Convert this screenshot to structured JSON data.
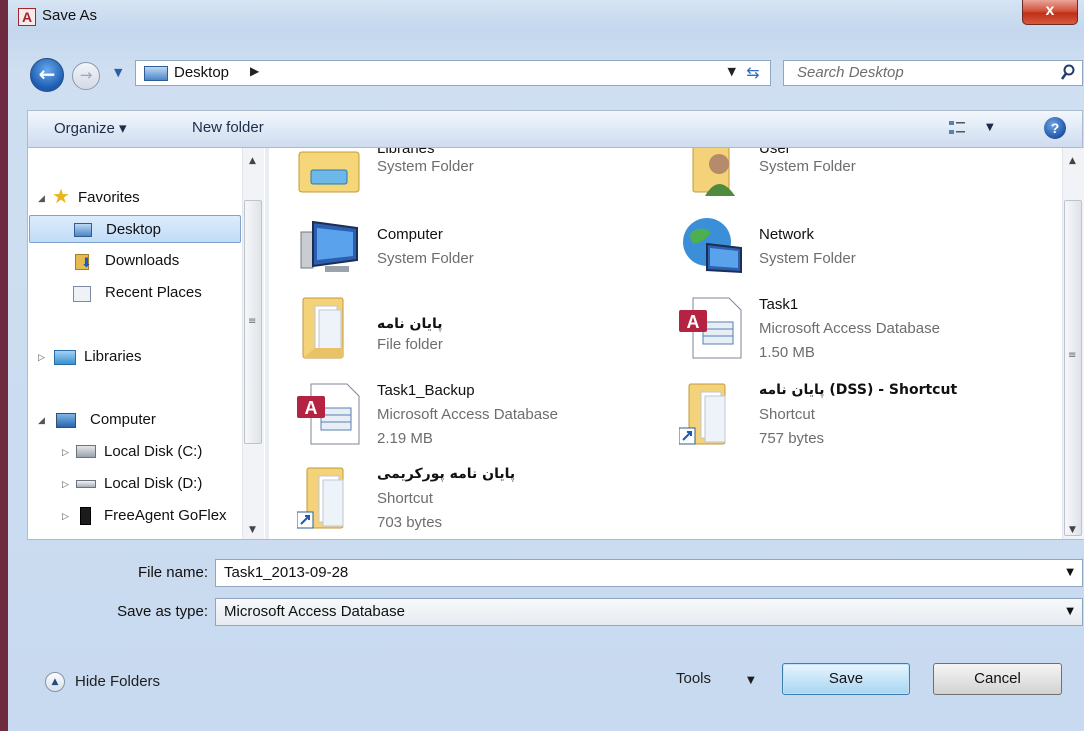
{
  "window": {
    "title": "Save As",
    "app_icon_letter": "A",
    "close_glyph": "x"
  },
  "nav": {
    "back_glyph": "←",
    "forward_glyph": "→",
    "address": {
      "location": "Desktop",
      "chevron": "▶"
    },
    "search": {
      "placeholder": "Search Desktop"
    }
  },
  "toolbar": {
    "organize_label": "Organize ▾",
    "new_folder_label": "New folder",
    "help_glyph": "?"
  },
  "sidebar": {
    "favorites": {
      "label": "Favorites",
      "items": [
        {
          "label": "Desktop",
          "selected": true
        },
        {
          "label": "Downloads"
        },
        {
          "label": "Recent Places"
        }
      ]
    },
    "libraries": {
      "label": "Libraries"
    },
    "computer": {
      "label": "Computer",
      "items": [
        {
          "label": "Local Disk (C:)"
        },
        {
          "label": "Local Disk (D:)"
        },
        {
          "label": "FreeAgent GoFlex"
        }
      ]
    }
  },
  "files": [
    {
      "name": "Libraries",
      "type": "System Folder",
      "size": "",
      "icon": "libraries-icon"
    },
    {
      "name": "User",
      "type": "System Folder",
      "size": "",
      "icon": "user-folder-icon"
    },
    {
      "name": "Computer",
      "type": "System Folder",
      "size": "",
      "icon": "computer-icon"
    },
    {
      "name": "Network",
      "type": "System Folder",
      "size": "",
      "icon": "network-icon"
    },
    {
      "name": "پایان نامه",
      "type": "File folder",
      "size": "",
      "icon": "folder-icon"
    },
    {
      "name": "Task1",
      "type": "Microsoft Access Database",
      "size": "1.50 MB",
      "icon": "access-database-icon"
    },
    {
      "name": "Task1_Backup",
      "type": "Microsoft Access Database",
      "size": "2.19 MB",
      "icon": "access-database-icon"
    },
    {
      "name": "پایان نامه (DSS) - Shortcut",
      "type": "Shortcut",
      "size": "757 bytes",
      "icon": "shortcut-folder-icon"
    },
    {
      "name": "پایان نامه پورکریمی",
      "type": "Shortcut",
      "size": "703 bytes",
      "icon": "shortcut-folder-icon"
    }
  ],
  "form": {
    "file_name_label": "File name:",
    "file_name_value": "Task1_2013-09-28",
    "save_type_label": "Save as type:",
    "save_type_value": "Microsoft Access Database"
  },
  "footer": {
    "hide_folders_label": "Hide Folders",
    "tools_label": "Tools",
    "save_label": "Save",
    "cancel_label": "Cancel"
  },
  "colors": {
    "accent": "#1b5bb0",
    "window_frame": "#c8daf0",
    "close_red": "#c02f16"
  }
}
